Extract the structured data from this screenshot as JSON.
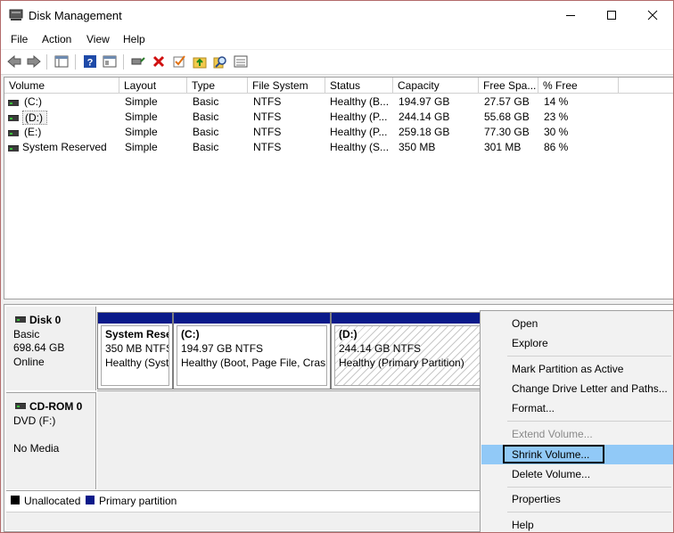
{
  "window": {
    "title": "Disk Management"
  },
  "menu": [
    "File",
    "Action",
    "View",
    "Help"
  ],
  "toolbar_icons": [
    "back-arrow-icon",
    "forward-arrow-icon",
    "console-tree-icon",
    "help-icon",
    "properties-icon",
    "connect-icon",
    "delete-icon",
    "check-icon",
    "folder-up-icon",
    "search-icon",
    "list-view-icon"
  ],
  "volume_list": {
    "columns": [
      "Volume",
      "Layout",
      "Type",
      "File System",
      "Status",
      "Capacity",
      "Free Spa...",
      "% Free"
    ],
    "rows": [
      [
        "(C:)",
        "Simple",
        "Basic",
        "NTFS",
        "Healthy (B...",
        "194.97 GB",
        "27.57 GB",
        "14 %"
      ],
      [
        "(D:)",
        "Simple",
        "Basic",
        "NTFS",
        "Healthy (P...",
        "244.14 GB",
        "55.68 GB",
        "23 %"
      ],
      [
        "(E:)",
        "Simple",
        "Basic",
        "NTFS",
        "Healthy (P...",
        "259.18 GB",
        "77.30 GB",
        "30 %"
      ],
      [
        "System Reserved",
        "Simple",
        "Basic",
        "NTFS",
        "Healthy (S...",
        "350 MB",
        "301 MB",
        "86 %"
      ]
    ]
  },
  "disks": {
    "disk0": {
      "name": "Disk 0",
      "type": "Basic",
      "size": "698.64 GB",
      "state": "Online",
      "partitions": [
        {
          "name": "System Rese",
          "size": "350 MB NTFS",
          "status": "Healthy (Syst"
        },
        {
          "name": "(C:)",
          "size": "194.97 GB NTFS",
          "status": "Healthy (Boot, Page File, Crash"
        },
        {
          "name": "(D:)",
          "size": "244.14 GB NTFS",
          "status": "Healthy (Primary Partition)"
        }
      ]
    },
    "cdrom0": {
      "name": "CD-ROM 0",
      "type": "DVD (F:)",
      "state": "No Media"
    }
  },
  "legend": {
    "unallocated": "Unallocated",
    "primary": "Primary partition",
    "unallocated_color": "#000000",
    "primary_color": "#0a1a8a"
  },
  "context_menu": {
    "open": "Open",
    "explore": "Explore",
    "mark_active": "Mark Partition as Active",
    "change_letter": "Change Drive Letter and Paths...",
    "format": "Format...",
    "extend": "Extend Volume...",
    "shrink": "Shrink Volume...",
    "delete": "Delete Volume...",
    "properties": "Properties",
    "help": "Help"
  }
}
